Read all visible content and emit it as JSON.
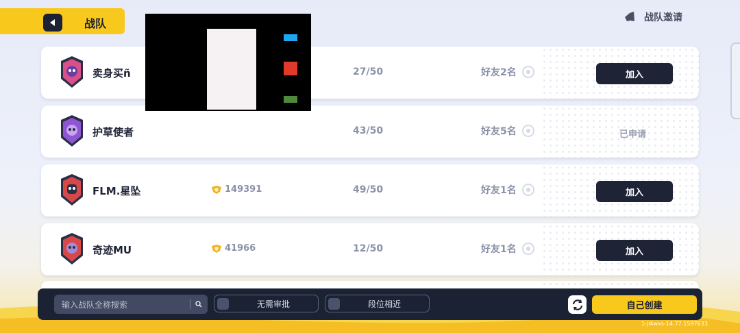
{
  "header": {
    "title": "战队",
    "invite_label": "战队邀请"
  },
  "teams": [
    {
      "name": "卖身买ñ",
      "score": "",
      "members": "27/50",
      "friends": "好友2名",
      "action": "加入",
      "status": "join",
      "badge_color": "#d9508a"
    },
    {
      "name": "护草使者",
      "score": "",
      "members": "43/50",
      "friends": "好友5名",
      "action": "已申请",
      "status": "applied",
      "badge_color": "#8e55d4"
    },
    {
      "name": "FLM.星坠",
      "score": "149391",
      "members": "49/50",
      "friends": "好友1名",
      "action": "加入",
      "status": "join",
      "badge_color": "#d94848"
    },
    {
      "name": "奇迹MU",
      "score": "41966",
      "members": "12/50",
      "friends": "好友1名",
      "action": "加入",
      "status": "join",
      "badge_color": "#d94848"
    }
  ],
  "bottom": {
    "search_placeholder": "输入战队全称搜索",
    "filter_no_approval": "无需审批",
    "filter_rank_near": "段位相近",
    "create_label": "自己创建"
  },
  "watermark": "1-jl4wxs-14.77.1597633",
  "colors": {
    "accent": "#f8c81c",
    "dark": "#1e2336"
  }
}
